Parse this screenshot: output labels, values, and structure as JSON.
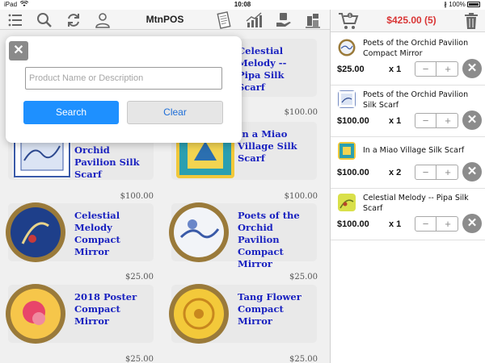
{
  "status_bar": {
    "device": "iPad",
    "time": "10:08",
    "battery": "100%"
  },
  "toolbar": {
    "title": "MtnPOS",
    "icons": [
      "menu-icon",
      "search-icon",
      "sync-icon",
      "customer-icon",
      "receipt-icon",
      "reports-icon",
      "payment-icon",
      "admin-icon"
    ]
  },
  "search": {
    "placeholder": "Product Name or Description",
    "value": "",
    "search_label": "Search",
    "clear_label": "Clear",
    "close_glyph": "✕"
  },
  "products": [
    {
      "name": "Celestial Melody -- Pipa Silk Scarf",
      "price": "$100.00"
    },
    {
      "name": "Orchid Pavilion Silk Scarf",
      "price": "$100.00"
    },
    {
      "name": "In a Miao Village Silk Scarf",
      "price": "$100.00"
    },
    {
      "name": "Celestial Melody Compact Mirror",
      "price": "$25.00"
    },
    {
      "name": "Poets of the Orchid Pavilion Compact Mirror",
      "price": "$25.00"
    },
    {
      "name": "2018 Poster Compact Mirror",
      "price": "$25.00"
    },
    {
      "name": "Tang Flower Compact Mirror",
      "price": "$25.00"
    }
  ],
  "cart": {
    "total": "$425.00 (5)",
    "items": [
      {
        "name": "Poets of the Orchid Pavilion Compact Mirror",
        "price": "$25.00",
        "qty": "x 1"
      },
      {
        "name": "Poets of the Orchid Pavilion Silk Scarf",
        "price": "$100.00",
        "qty": "x 1"
      },
      {
        "name": "In a Miao Village Silk Scarf",
        "price": "$100.00",
        "qty": "x 2"
      },
      {
        "name": "Celestial Melody -- Pipa Silk Scarf",
        "price": "$100.00",
        "qty": "x 1"
      }
    ],
    "minus_glyph": "−",
    "plus_glyph": "+",
    "remove_glyph": "✕"
  },
  "colors": {
    "accent_blue": "#1e90ff",
    "product_name": "#1a22c0",
    "total_red": "#d93535"
  }
}
